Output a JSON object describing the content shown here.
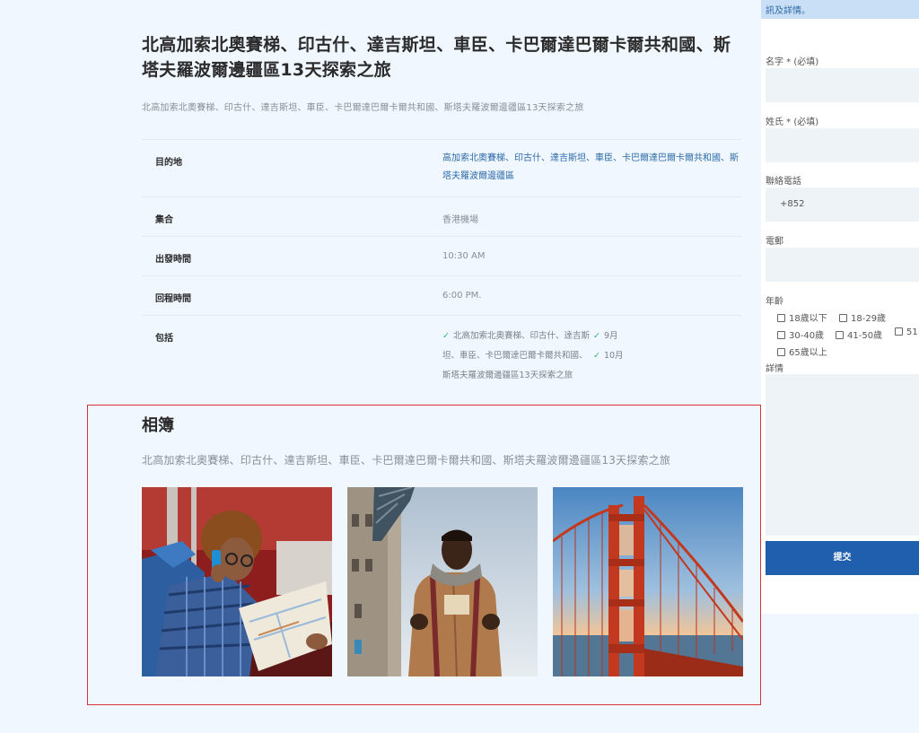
{
  "tour": {
    "title": "北高加索北奧賽梯、印古什、達吉斯坦、車臣、卡巴爾達巴爾卡爾共和國、斯塔夫羅波爾邊疆區13天探索之旅",
    "subtitle": "北高加索北奧賽梯、印古什、達吉斯坦、車臣、卡巴爾達巴爾卡爾共和國、斯塔夫羅波爾邊疆區13天探索之旅"
  },
  "details": {
    "destination_label": "目的地",
    "destination_value": "高加索北奧賽梯、印古什、達吉斯坦、車臣、卡巴爾達巴爾卡爾共和國、斯塔夫羅波爾邊疆區",
    "meeting_label": "集合",
    "meeting_value": "香港機場",
    "departure_label": "出發時間",
    "departure_value": "10:30 AM",
    "return_label": "回程時間",
    "return_value": "6:00 PM.",
    "includes_label": "包括",
    "includes": [
      "北高加索北奧賽梯、印古什、達吉斯坦、車臣、卡巴爾達巴爾卡爾共和國、斯塔夫羅波爾邊疆區13天探索之旅",
      "9月",
      "10月"
    ]
  },
  "album": {
    "title": "相簿",
    "subtitle": "北高加索北奧賽梯、印古什、達吉斯坦、車臣、卡巴爾達巴爾卡爾共和國、斯塔夫羅波爾邊疆區13天探索之旅"
  },
  "form": {
    "header": "訊及詳情。",
    "first_name_label": "名字 * (必填)",
    "last_name_label": "姓氏 * (必填)",
    "phone_label": "聯絡電話",
    "phone_prefix": "+852",
    "email_label": "電郵",
    "age_label": "年齡",
    "ages": [
      "18歲以下",
      "18-29歲",
      "30-40歲",
      "41-50歲",
      "51",
      "65歲以上"
    ],
    "details_label": "詳情",
    "submit_label": "提交"
  },
  "colors": {
    "page_bg": "#f0f7ff",
    "accent": "#1f5fae",
    "link": "#2d6aa8",
    "check": "#2fb27a",
    "highlight_frame": "#d9323b"
  }
}
